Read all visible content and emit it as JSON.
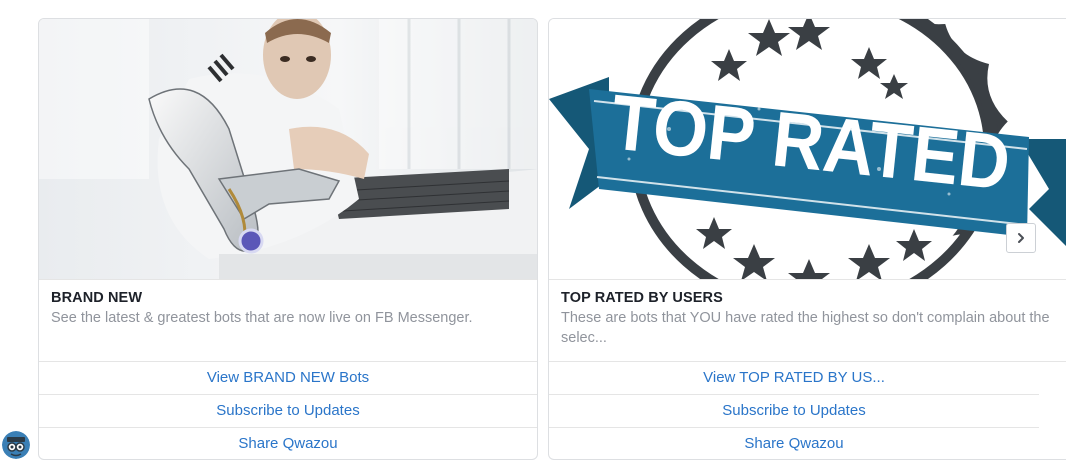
{
  "cards": [
    {
      "title": "BRAND NEW",
      "subtitle": "See the latest & greatest bots that are now live on FB Messenger.",
      "image_alt": "man-with-robotic-arm-image",
      "buttons": [
        "View BRAND NEW Bots",
        "Subscribe to Updates",
        "Share Qwazou"
      ]
    },
    {
      "title": "TOP RATED BY USERS",
      "subtitle": "These are bots that YOU have rated the highest so don't complain about the selec...",
      "stamp_text": "TOP RATED",
      "buttons": [
        "View TOP RATED BY US...",
        "Subscribe to Updates",
        "Share Qwazou"
      ]
    }
  ],
  "carousel": {
    "next_icon": "chevron-right-icon"
  },
  "avatar": {
    "icon": "bot-avatar-icon"
  },
  "colors": {
    "link": "#2a75c9",
    "title": "#1d2129",
    "subtitle": "#90949c",
    "stamp_blue": "#1c6f99",
    "stamp_dark": "#3a3f44",
    "border": "#dddfe2"
  }
}
